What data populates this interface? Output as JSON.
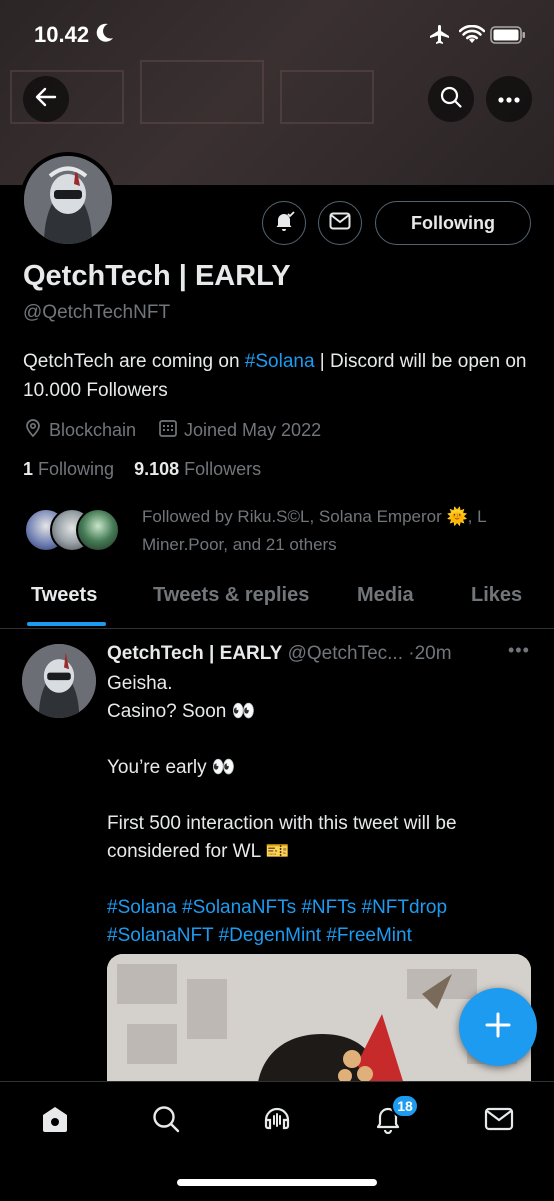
{
  "status_bar": {
    "time": "10.42"
  },
  "profile": {
    "name": "QetchTech | EARLY",
    "handle": "@QetchTechNFT",
    "bio_part1": "QetchTech are coming on ",
    "bio_link": "#Solana",
    "bio_part2": " | Discord will be open on 10.000 Followers",
    "location": "Blockchain",
    "joined": "Joined May 2022",
    "following_count": "1",
    "following_label": "Following",
    "followers_count": "9.108",
    "followers_label": "Followers",
    "followed_by_line1": "Followed by Riku.S©L, Solana Emperor 🌞, L",
    "followed_by_line2": "Miner.Poor, and 21 others",
    "following_button": "Following"
  },
  "tabs": [
    {
      "label": "Tweets",
      "active": true
    },
    {
      "label": "Tweets & replies",
      "active": false
    },
    {
      "label": "Media",
      "active": false
    },
    {
      "label": "Likes",
      "active": false
    }
  ],
  "tweet": {
    "author_name": "QetchTech | EARLY",
    "author_handle": "@QetchTec...",
    "age": "20m",
    "lines": [
      "Geisha.",
      "Casino? Soon 👀",
      "",
      "You’re early 👀",
      "",
      "First 500 interaction with this tweet will be considered for WL 🎫",
      "",
      "#Solana #SolanaNFTs #NFTs #NFTdrop",
      "#SolanaNFT  #DegenMint #FreeMint"
    ]
  },
  "navbar": {
    "notifications_badge": "18"
  },
  "colors": {
    "accent": "#1d9bf0",
    "secondary_text": "#71767b",
    "background": "#000000"
  },
  "icons": [
    "back-icon",
    "search-icon",
    "more-icon",
    "bell-icon",
    "mail-icon",
    "location-icon",
    "calendar-icon",
    "compose-icon",
    "home-icon",
    "spaces-icon"
  ]
}
